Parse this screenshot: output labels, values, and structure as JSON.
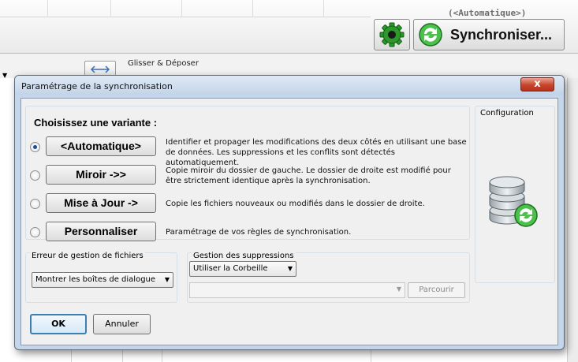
{
  "app": {
    "variant_hint": "(<Automatique>)",
    "sync_button_label": "Synchroniser...",
    "drag_drop_label": "Glisser & Déposer",
    "icons": [
      "gear-icon",
      "sync-icon",
      "swap-icon"
    ]
  },
  "dialog": {
    "title": "Paramétrage de la synchronisation",
    "close_label": "x",
    "variants": {
      "heading": "Choisissez une variante :",
      "selected": "automatic",
      "items": [
        {
          "id": "automatic",
          "label": "<Automatique>",
          "selected": true,
          "description": "Identifier et propager les modifications des deux côtés en utilisant une base de données. Les suppressions et les conflits sont détectés automatiquement."
        },
        {
          "id": "mirror",
          "label": "Miroir ->>",
          "selected": false,
          "description": "Copie miroir du dossier de gauche. Le dossier de droite est modifié pour être strictement identique après la synchronisation."
        },
        {
          "id": "update",
          "label": "Mise à Jour ->",
          "selected": false,
          "description": "Copie les fichiers nouveaux ou modifiés dans le dossier de droite."
        },
        {
          "id": "custom",
          "label": "Personnaliser",
          "selected": false,
          "description": "Paramétrage de vos règles de synchronisation."
        }
      ]
    },
    "configuration": {
      "label": "Configuration",
      "icon": "database-sync-icon"
    },
    "file_errors": {
      "label": "Erreur de gestion de fichiers",
      "value": "Montrer les boîtes de dialogue"
    },
    "deletion": {
      "label": "Gestion des suppressions",
      "value": "Utiliser la Corbeille",
      "path_value": "",
      "browse_label": "Parcourir"
    },
    "buttons": {
      "ok": "OK",
      "cancel": "Annuler"
    }
  },
  "colors": {
    "dialog_frame": "#c5d6ea",
    "close_button": "#c8442b",
    "sync_green": "#2fa52f",
    "default_button_border": "#3c7fb1"
  }
}
